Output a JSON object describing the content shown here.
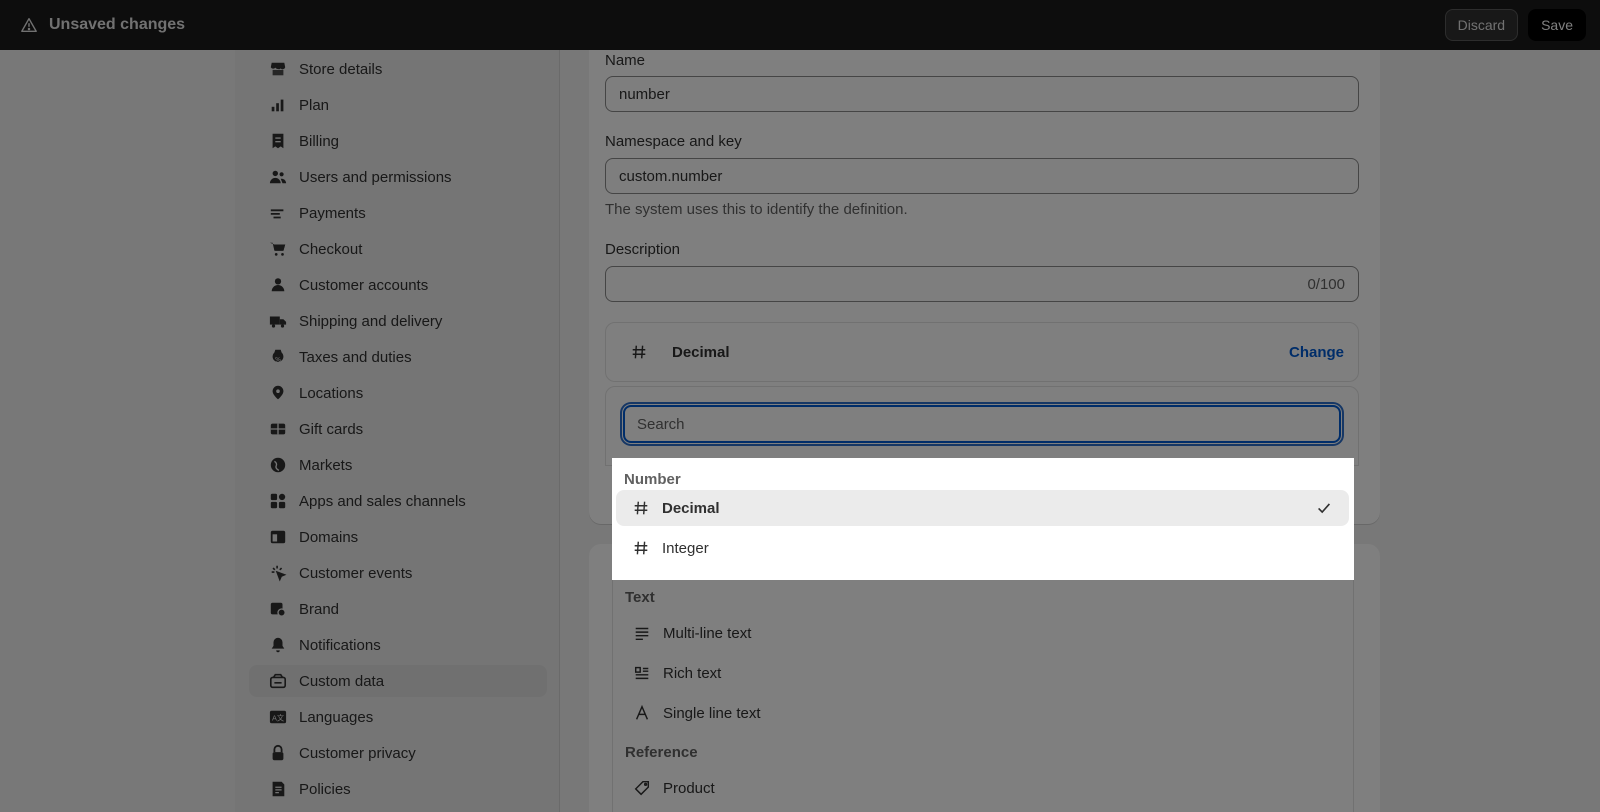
{
  "topbar": {
    "title": "Unsaved changes",
    "discard_label": "Discard",
    "save_label": "Save"
  },
  "sidebar": {
    "items": [
      {
        "label": "Store details",
        "icon": "store-icon"
      },
      {
        "label": "Plan",
        "icon": "plan-icon"
      },
      {
        "label": "Billing",
        "icon": "billing-icon"
      },
      {
        "label": "Users and permissions",
        "icon": "users-icon"
      },
      {
        "label": "Payments",
        "icon": "payments-icon"
      },
      {
        "label": "Checkout",
        "icon": "cart-icon"
      },
      {
        "label": "Customer accounts",
        "icon": "person-icon"
      },
      {
        "label": "Shipping and delivery",
        "icon": "truck-icon"
      },
      {
        "label": "Taxes and duties",
        "icon": "tax-icon"
      },
      {
        "label": "Locations",
        "icon": "location-icon"
      },
      {
        "label": "Gift cards",
        "icon": "gift-card-icon"
      },
      {
        "label": "Markets",
        "icon": "globe-icon"
      },
      {
        "label": "Apps and sales channels",
        "icon": "apps-icon"
      },
      {
        "label": "Domains",
        "icon": "domains-icon"
      },
      {
        "label": "Customer events",
        "icon": "cursor-icon"
      },
      {
        "label": "Brand",
        "icon": "brand-icon"
      },
      {
        "label": "Notifications",
        "icon": "bell-icon"
      },
      {
        "label": "Custom data",
        "icon": "custom-data-icon",
        "active": true
      },
      {
        "label": "Languages",
        "icon": "languages-icon"
      },
      {
        "label": "Customer privacy",
        "icon": "lock-icon"
      },
      {
        "label": "Policies",
        "icon": "policies-icon"
      }
    ]
  },
  "form": {
    "name_label": "Name",
    "name_value": "number",
    "namespace_label": "Namespace and key",
    "namespace_value": "custom.number",
    "namespace_help": "The system uses this to identify the definition.",
    "description_label": "Description",
    "description_count": "0/100",
    "type_name": "Decimal",
    "change_label": "Change",
    "search_placeholder": "Search"
  },
  "dropdown": {
    "sections": [
      {
        "title": "Number",
        "options": [
          {
            "label": "Decimal",
            "icon": "hash-icon",
            "selected": true
          },
          {
            "label": "Integer",
            "icon": "hash-icon",
            "selected": false
          }
        ]
      },
      {
        "title": "Text",
        "options": [
          {
            "label": "Multi-line text",
            "icon": "multiline-text-icon"
          },
          {
            "label": "Rich text",
            "icon": "rich-text-icon"
          },
          {
            "label": "Single line text",
            "icon": "single-line-text-icon"
          }
        ]
      },
      {
        "title": "Reference",
        "options": [
          {
            "label": "Product",
            "icon": "product-tag-icon"
          }
        ]
      }
    ]
  },
  "colors": {
    "accent": "#005bd3",
    "topbar": "#1a1a1a"
  }
}
